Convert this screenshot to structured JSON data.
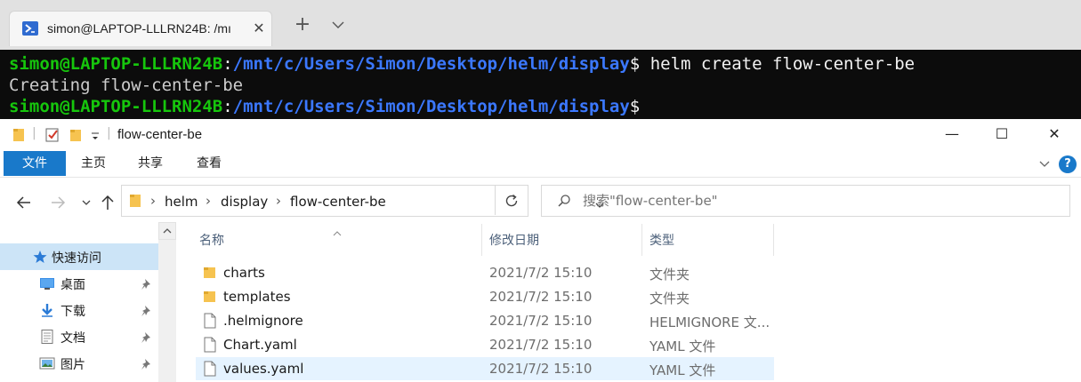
{
  "terminal": {
    "tab_title": "simon@LAPTOP-LLLRN24B: /mı",
    "tab_close": "✕",
    "new_tab": "+",
    "lines": [
      {
        "user": "simon@LAPTOP-LLLRN24B",
        "colon": ":",
        "path": "/mnt/c/Users/Simon/Desktop/helm/display",
        "prompt": "$",
        "cmd": " helm create flow-center-be"
      },
      {
        "text": "Creating flow-center-be"
      },
      {
        "user": "simon@LAPTOP-LLLRN24B",
        "colon": ":",
        "path": "/mnt/c/Users/Simon/Desktop/helm/display",
        "prompt": "$",
        "cmd": ""
      }
    ],
    "colors": {
      "background": "#0c0c0c",
      "user": "#16c60c",
      "path": "#3b78ff",
      "text": "#cccccc"
    }
  },
  "explorer": {
    "title_sep": "|",
    "title": "flow-center-be",
    "window_controls": {
      "minimize": "—",
      "maximize": "☐",
      "close": "✕"
    },
    "ribbon_tabs": [
      "文件",
      "主页",
      "共享",
      "查看"
    ],
    "help": "?",
    "breadcrumb": [
      "helm",
      "display",
      "flow-center-be"
    ],
    "search_placeholder": "搜索\"flow-center-be\"",
    "nav_items": [
      {
        "label": "快速访问",
        "icon": "star-icon"
      },
      {
        "label": "桌面",
        "icon": "desktop-icon"
      },
      {
        "label": "下载",
        "icon": "download-icon"
      },
      {
        "label": "文档",
        "icon": "document-icon"
      },
      {
        "label": "图片",
        "icon": "pictures-icon"
      }
    ],
    "columns": [
      "名称",
      "修改日期",
      "类型"
    ],
    "files": [
      {
        "name": "charts",
        "date": "2021/7/2 15:10",
        "type": "文件夹",
        "icon": "folder-icon"
      },
      {
        "name": "templates",
        "date": "2021/7/2 15:10",
        "type": "文件夹",
        "icon": "folder-icon"
      },
      {
        "name": ".helmignore",
        "date": "2021/7/2 15:10",
        "type": "HELMIGNORE 文...",
        "icon": "file-icon"
      },
      {
        "name": "Chart.yaml",
        "date": "2021/7/2 15:10",
        "type": "YAML 文件",
        "icon": "file-icon"
      },
      {
        "name": "values.yaml",
        "date": "2021/7/2 15:10",
        "type": "YAML 文件",
        "icon": "file-icon"
      }
    ],
    "colors": {
      "accent": "#1979ca",
      "selection": "#cce4f7",
      "hover": "#e5f3ff",
      "folder": "#f6c350"
    }
  }
}
